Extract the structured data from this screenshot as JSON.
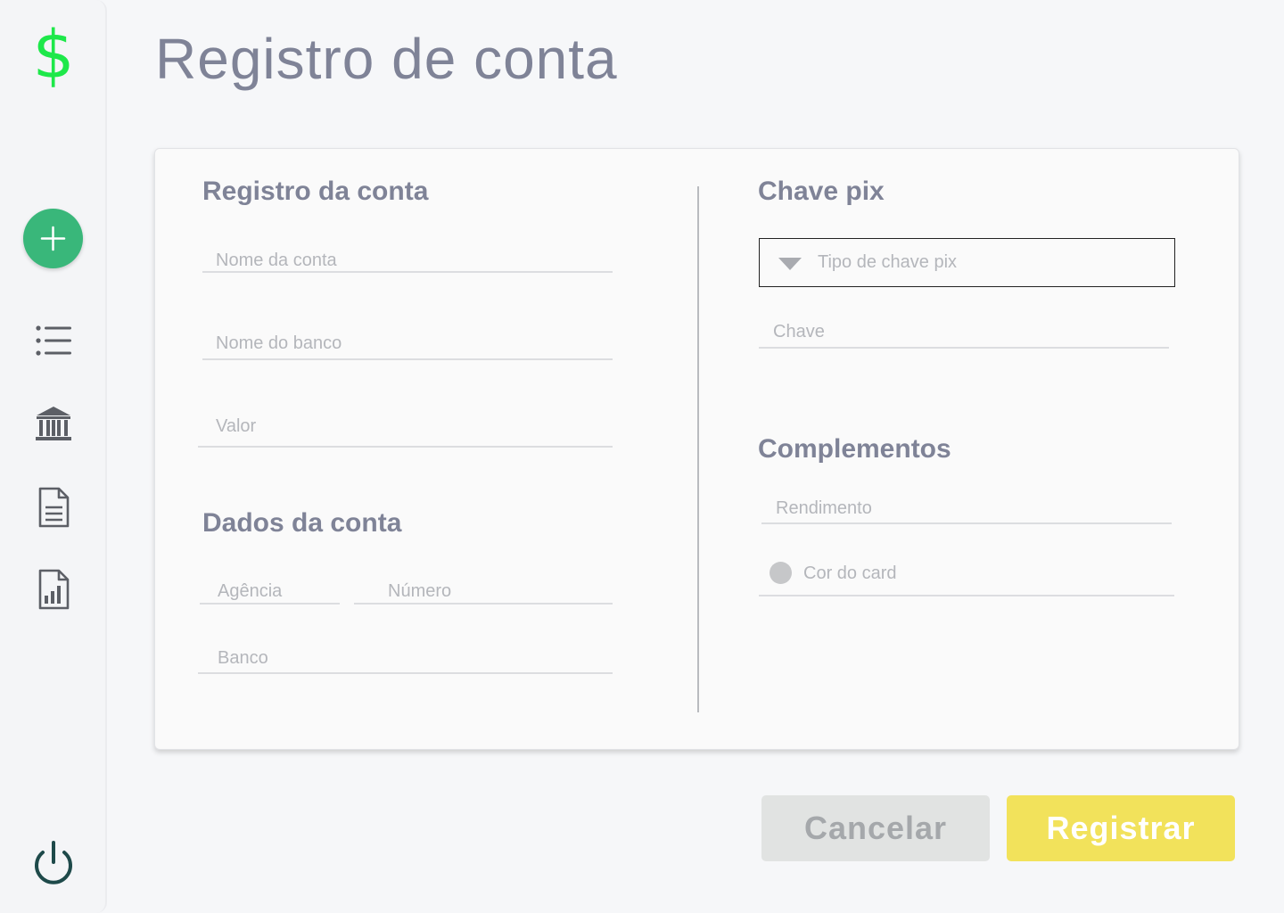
{
  "app": {
    "logo_symbol": "$",
    "brand_color": "#1ee84a",
    "accent_color": "#39b77a",
    "primary_button_color": "#f2e25b"
  },
  "sidebar": {
    "items": [
      {
        "icon": "plus-icon",
        "label": ""
      },
      {
        "icon": "list-icon",
        "label": ""
      },
      {
        "icon": "bank-icon",
        "label": ""
      },
      {
        "icon": "document-icon",
        "label": ""
      },
      {
        "icon": "report-chart-icon",
        "label": ""
      }
    ],
    "logout_icon": "power-icon"
  },
  "page": {
    "title": "Registro de conta"
  },
  "form": {
    "account_section": {
      "title": "Registro da conta",
      "account_name_placeholder": "Nome da conta",
      "bank_name_placeholder": "Nome do banco",
      "value_placeholder": "Valor"
    },
    "account_data_section": {
      "title": "Dados da conta",
      "agency_placeholder": "Agência",
      "number_placeholder": "Número",
      "bank_placeholder": "Banco"
    },
    "pix_section": {
      "title": "Chave pix",
      "key_type_placeholder": "Tipo de chave pix",
      "key_placeholder": "Chave"
    },
    "extras_section": {
      "title": "Complementos",
      "yield_placeholder": "Rendimento",
      "card_color_placeholder": "Cor do card",
      "card_color_value": "#c6c7c9"
    }
  },
  "actions": {
    "cancel_label": "Cancelar",
    "register_label": "Registrar"
  }
}
